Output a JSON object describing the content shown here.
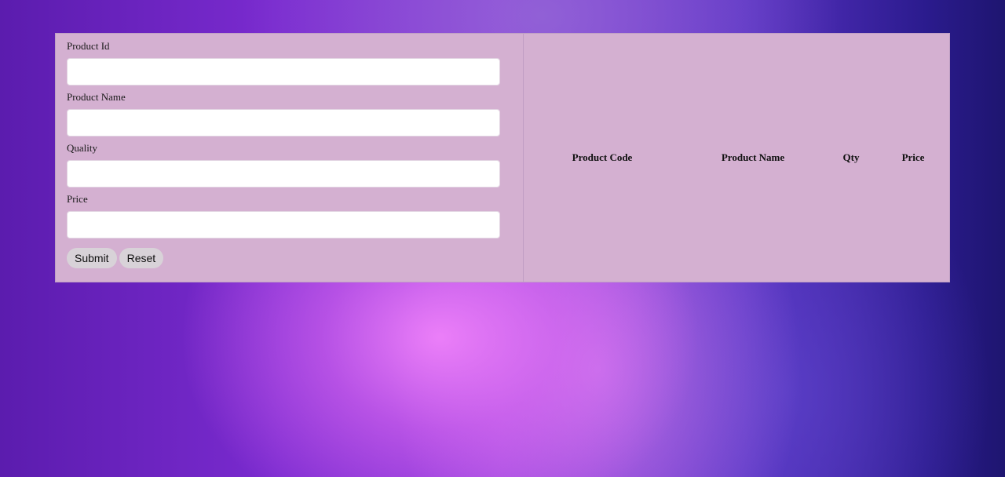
{
  "form": {
    "fields": [
      {
        "label": "Product Id",
        "value": "",
        "placeholder": ""
      },
      {
        "label": "Product Name",
        "value": "",
        "placeholder": ""
      },
      {
        "label": "Quality",
        "value": "",
        "placeholder": ""
      },
      {
        "label": "Price",
        "value": "",
        "placeholder": ""
      }
    ],
    "submit_label": "Submit",
    "reset_label": "Reset"
  },
  "table": {
    "headers": [
      "Product Code",
      "Product Name",
      "Qty",
      "Price"
    ],
    "rows": []
  },
  "colors": {
    "panel_background": "#d4b0d1",
    "button_background": "#d8d2d8",
    "page_background": "#7b2bd0"
  }
}
